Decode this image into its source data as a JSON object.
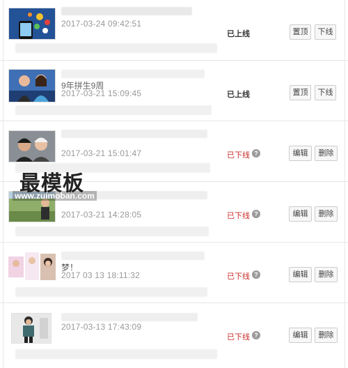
{
  "rows": [
    {
      "title": "",
      "date": "2017-03-24 09:42:51",
      "status": "已上线",
      "status_state": "online",
      "btn1": "置顶",
      "btn2": "下线",
      "thumb_icon": "phone-apps-image"
    },
    {
      "title": "9年拼生9周",
      "date": "2017-03-21 15:09:45",
      "status": "已上线",
      "status_state": "online",
      "btn1": "置顶",
      "btn2": "下线",
      "thumb_icon": "couple-photo-image"
    },
    {
      "title": "",
      "date": "2017-03-21 15:01:47",
      "status": "已下线",
      "status_state": "offline",
      "btn1": "编辑",
      "btn2": "删除",
      "thumb_icon": "two-people-image"
    },
    {
      "title": "",
      "date": "2017-03-21 14:28:05",
      "status": "已下线",
      "status_state": "offline",
      "btn1": "编辑",
      "btn2": "删除",
      "thumb_icon": "outdoor-person-image"
    },
    {
      "title": "梦！",
      "date": "2017 03 13 18:11:32",
      "status": "已下线",
      "status_state": "offline",
      "btn1": "编辑",
      "btn2": "删除",
      "thumb_icon": "collage-image"
    },
    {
      "title": "",
      "date": "2017-03-13 17:43:09",
      "status": "已下线",
      "status_state": "offline",
      "btn1": "编辑",
      "btn2": "删除",
      "thumb_icon": "standing-person-image"
    }
  ],
  "watermark": {
    "cn": "最模板",
    "url": "www.zuimoban.com"
  },
  "help_icon": "?",
  "colors": {
    "offline": "#c9302c",
    "online": "#333333",
    "date": "#999999"
  }
}
